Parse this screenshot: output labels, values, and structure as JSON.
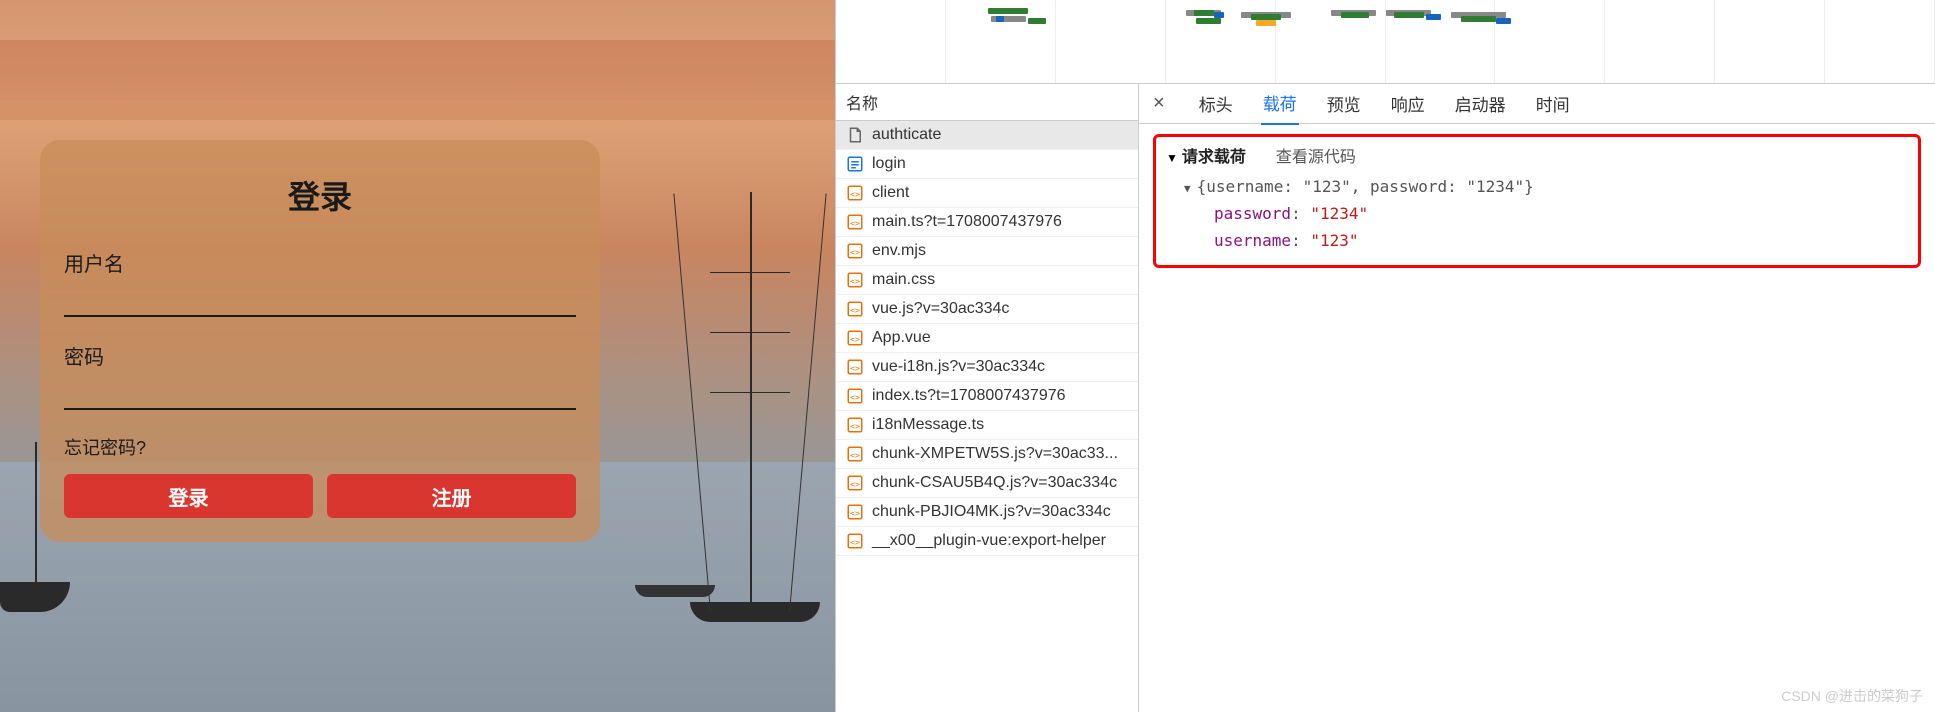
{
  "login": {
    "title": "登录",
    "username_label": "用户名",
    "password_label": "密码",
    "forgot": "忘记密码?",
    "login_btn": "登录",
    "register_btn": "注册"
  },
  "devtools": {
    "name_header": "名称",
    "tabs": {
      "headers": "标头",
      "payload": "载荷",
      "preview": "预览",
      "response": "响应",
      "initiator": "启动器",
      "timing": "时间"
    },
    "payload": {
      "title": "请求载荷",
      "view_source": "查看源代码",
      "summary_prefix": "{username: ",
      "summary_user": "\"123\"",
      "summary_mid": ", password: ",
      "summary_pass": "\"1234\"",
      "summary_suffix": "}",
      "props": [
        {
          "key": "password",
          "value": "\"1234\""
        },
        {
          "key": "username",
          "value": "\"123\""
        }
      ]
    },
    "requests": [
      {
        "name": "authticate",
        "icon": "doc"
      },
      {
        "name": "login",
        "icon": "html"
      },
      {
        "name": "client",
        "icon": "js"
      },
      {
        "name": "main.ts?t=1708007437976",
        "icon": "js"
      },
      {
        "name": "env.mjs",
        "icon": "js"
      },
      {
        "name": "main.css",
        "icon": "js"
      },
      {
        "name": "vue.js?v=30ac334c",
        "icon": "js"
      },
      {
        "name": "App.vue",
        "icon": "js"
      },
      {
        "name": "vue-i18n.js?v=30ac334c",
        "icon": "js"
      },
      {
        "name": "index.ts?t=1708007437976",
        "icon": "js"
      },
      {
        "name": "i18nMessage.ts",
        "icon": "js"
      },
      {
        "name": "chunk-XMPETW5S.js?v=30ac33...",
        "icon": "js"
      },
      {
        "name": "chunk-CSAU5B4Q.js?v=30ac334c",
        "icon": "js"
      },
      {
        "name": "chunk-PBJIO4MK.js?v=30ac334c",
        "icon": "js"
      },
      {
        "name": "__x00__plugin-vue:export-helper",
        "icon": "js"
      }
    ]
  },
  "watermark": "CSDN @进击的菜狗子"
}
